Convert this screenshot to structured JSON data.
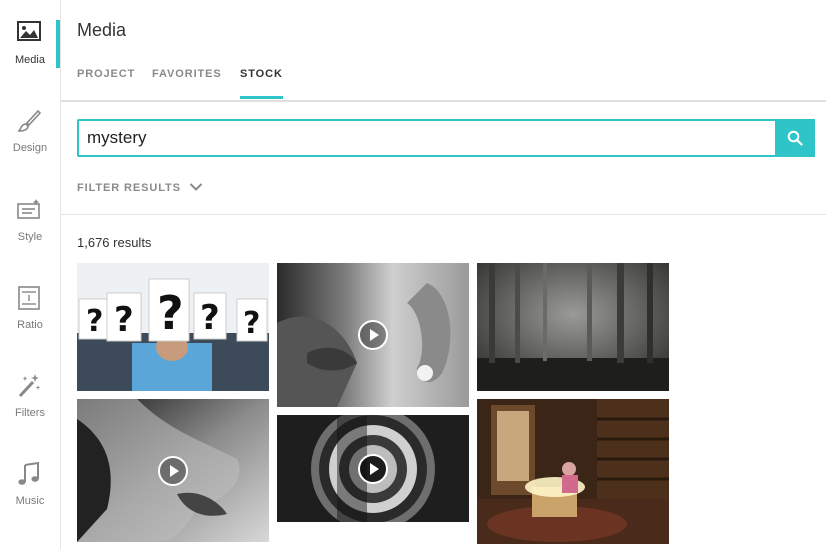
{
  "sidebar": {
    "items": [
      {
        "label": "Media",
        "icon": "image-icon",
        "active": true
      },
      {
        "label": "Design",
        "icon": "brush-icon",
        "active": false
      },
      {
        "label": "Style",
        "icon": "style-icon",
        "active": false
      },
      {
        "label": "Ratio",
        "icon": "ratio-icon",
        "active": false
      },
      {
        "label": "Filters",
        "icon": "magic-wand-icon",
        "active": false
      },
      {
        "label": "Music",
        "icon": "music-note-icon",
        "active": false
      }
    ]
  },
  "header": {
    "title": "Media",
    "tabs": [
      {
        "label": "PROJECT",
        "active": false
      },
      {
        "label": "FAVORITES",
        "active": false
      },
      {
        "label": "STOCK",
        "active": true
      }
    ]
  },
  "search": {
    "value": "mystery",
    "button_icon": "search-icon"
  },
  "filter": {
    "label": "FILTER RESULTS",
    "icon": "chevron-down-icon"
  },
  "results": {
    "count_text": "1,676 results",
    "items": [
      {
        "kind": "image",
        "subject": "people holding question mark cards"
      },
      {
        "kind": "video",
        "subject": "close-up whisper"
      },
      {
        "kind": "image",
        "subject": "foggy forest"
      },
      {
        "kind": "video",
        "subject": "face close-up"
      },
      {
        "kind": "video",
        "subject": "spinning spiral"
      },
      {
        "kind": "image",
        "subject": "glowing box in room"
      }
    ]
  },
  "colors": {
    "accent": "#2ec4c8",
    "text": "#333333",
    "muted": "#8a8a8a"
  }
}
